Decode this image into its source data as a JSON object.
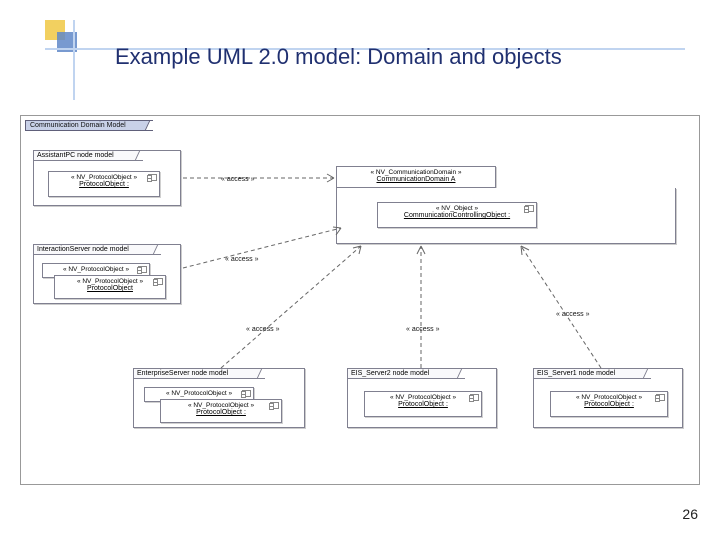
{
  "slide": {
    "title": "Example UML 2.0 model: Domain and objects",
    "page_number": "26"
  },
  "diagram": {
    "outer_package": "Communication Domain Model",
    "domain_class": {
      "stereotype": "« NV_CommunicationDomain »",
      "name": "CommunicationDomain A"
    },
    "controller_obj": {
      "stereotype": "« NV_Object »",
      "name": "CommunicationControllingObject :"
    },
    "nodes": {
      "assistantpc": {
        "label": "AssistantPC node model",
        "obj1": {
          "stereotype": "« NV_ProtocolObject »",
          "name": "ProtocolObject :"
        }
      },
      "interaction": {
        "label": "InteractionServer node model",
        "obj1": {
          "stereotype": "« NV_ProtocolObject »"
        },
        "obj2": {
          "stereotype": "« NV_ProtocolObject »",
          "name": "ProtocolObject"
        }
      },
      "enterprise": {
        "label": "EnterpriseServer node model",
        "obj1": {
          "stereotype": "« NV_ProtocolObject »"
        },
        "obj2": {
          "stereotype": "« NV_ProtocolObject »",
          "name": "ProtocolObject :"
        }
      },
      "eis2": {
        "label": "EIS_Server2 node model",
        "obj1": {
          "stereotype": "« NV_ProtocolObject »",
          "name": "ProtocolObject :"
        }
      },
      "eis1": {
        "label": "EIS_Server1 node model",
        "obj1": {
          "stereotype": "« NV_ProtocolObject »",
          "name": "ProtocolObject :"
        }
      }
    },
    "relations": {
      "access": "« access »"
    }
  }
}
